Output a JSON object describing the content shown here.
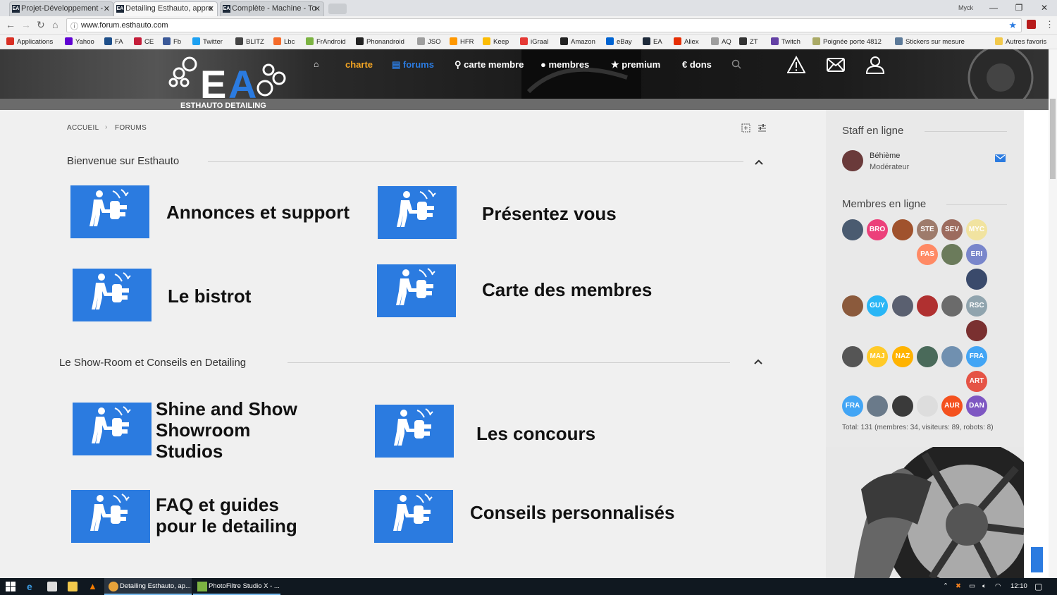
{
  "browser": {
    "tabs": [
      {
        "title": "Projet-Développement -",
        "favicon": "EA"
      },
      {
        "title": "Detailing Esthauto, appre",
        "favicon": "EA"
      },
      {
        "title": "Complète - Machine - To",
        "favicon": "EA"
      }
    ],
    "user_label": "Myck",
    "url": "www.forum.esthauto.com",
    "window_controls": [
      "—",
      "❐",
      "✕"
    ],
    "bookmarks": [
      {
        "label": "Applications",
        "color": "#d93025"
      },
      {
        "label": "Yahoo",
        "color": "#6001d2"
      },
      {
        "label": "FA",
        "color": "#1e4f8a"
      },
      {
        "label": "CE",
        "color": "#c41e3a"
      },
      {
        "label": "Fb",
        "color": "#3b5998"
      },
      {
        "label": "Twitter",
        "color": "#1da1f2"
      },
      {
        "label": "BLITZ",
        "color": "#444444"
      },
      {
        "label": "Lbc",
        "color": "#f56b2a"
      },
      {
        "label": "FrAndroid",
        "color": "#7cb342"
      },
      {
        "label": "Phonandroid",
        "color": "#222222"
      },
      {
        "label": "JSO",
        "color": "#9e9e9e"
      },
      {
        "label": "HFR",
        "color": "#ff9800"
      },
      {
        "label": "Keep",
        "color": "#fbbc04"
      },
      {
        "label": "iGraal",
        "color": "#e53935"
      },
      {
        "label": "Amazon",
        "color": "#222222"
      },
      {
        "label": "eBay",
        "color": "#0064d2"
      },
      {
        "label": "EA",
        "color": "#1e2a3a"
      },
      {
        "label": "Aliex",
        "color": "#e62e04"
      },
      {
        "label": "AQ",
        "color": "#9e9e9e"
      },
      {
        "label": "ZT",
        "color": "#333333"
      },
      {
        "label": "Twitch",
        "color": "#6441a5"
      },
      {
        "label": "Poignée porte 4812",
        "color": "#aaaa66"
      },
      {
        "label": "Stickers sur mesure",
        "color": "#5c7a99"
      },
      {
        "label": "Autres favoris",
        "color": "#f2c94c"
      }
    ]
  },
  "site": {
    "logo_text": "ESTHAUTO DETAILING",
    "nav": [
      "charte",
      "forums",
      "carte membre",
      "membres",
      "premium",
      "dons"
    ],
    "nav_colors": {
      "charte": "#f5a623",
      "forums": "#2b7be0",
      "default": "#ffffff"
    }
  },
  "breadcrumb": [
    "ACCUEIL",
    "FORUMS"
  ],
  "sections": [
    {
      "title": "Bienvenue sur Esthauto",
      "forums": [
        "Annonces et support",
        "Présentez vous",
        "Le bistrot",
        "Carte des membres"
      ]
    },
    {
      "title": "Le Show-Room et Conseils en Detailing",
      "forums": [
        "Shine and Show Showroom Studios",
        "Les concours",
        "FAQ et guides pour le detailing",
        "Conseils personnalisés"
      ]
    }
  ],
  "sidebar": {
    "staff_title": "Staff en ligne",
    "staff": [
      {
        "name": "Béhième",
        "role": "Modérateur"
      }
    ],
    "members_title": "Membres en ligne",
    "members": [
      {
        "label": "",
        "color": "#4a5b70"
      },
      {
        "label": "BRO",
        "color": "#ec407a"
      },
      {
        "label": "",
        "color": "#a0522d"
      },
      {
        "label": "STE",
        "color": "#9e7b6b"
      },
      {
        "label": "SEV",
        "color": "#9c6b5e"
      },
      {
        "label": "MYC",
        "color": "#f1e3a0"
      },
      {
        "label": "PAS",
        "color": "#ff8a65"
      },
      {
        "label": "",
        "color": "#6b7b5b"
      },
      {
        "label": "ERI",
        "color": "#7986cb"
      },
      {
        "label": "",
        "color": "#3a4a6b"
      },
      {
        "label": "",
        "color": "#8b5a3c"
      },
      {
        "label": "GUY",
        "color": "#29b6f6"
      },
      {
        "label": "",
        "color": "#5a6070"
      },
      {
        "label": "",
        "color": "#b03030"
      },
      {
        "label": "",
        "color": "#6b6b6b"
      },
      {
        "label": "RSC",
        "color": "#90a4ae"
      },
      {
        "label": "",
        "color": "#7a3030"
      },
      {
        "label": "",
        "color": "#555555"
      },
      {
        "label": "MAJ",
        "color": "#ffca28"
      },
      {
        "label": "NAZ",
        "color": "#ffb300"
      },
      {
        "label": "",
        "color": "#4a6a5a"
      },
      {
        "label": "",
        "color": "#7090b0"
      },
      {
        "label": "FRA",
        "color": "#42a5f5"
      },
      {
        "label": "ART",
        "color": "#e55345"
      },
      {
        "label": "FRA",
        "color": "#42a5f5"
      },
      {
        "label": "",
        "color": "#6a7a8a"
      },
      {
        "label": "",
        "color": "#3a3a3a"
      },
      {
        "label": "",
        "color": "#dddddd"
      },
      {
        "label": "AUR",
        "color": "#f4511e"
      },
      {
        "label": "DAN",
        "color": "#7e57c2"
      }
    ],
    "total": "Total: 131 (membres: 34, visiteurs: 89, robots: 8)"
  },
  "taskbar": {
    "items": [
      "Detailing Esthauto, ap...",
      "PhotoFiltre Studio X - ..."
    ],
    "time": "12:10"
  }
}
